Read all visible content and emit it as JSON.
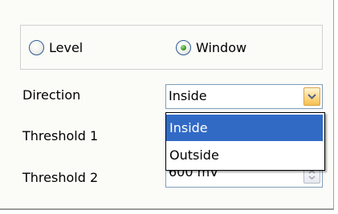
{
  "mode": {
    "options": [
      {
        "label": "Level",
        "checked": false
      },
      {
        "label": "Window",
        "checked": true
      }
    ]
  },
  "direction": {
    "label": "Direction",
    "selected": "Inside",
    "options": [
      "Inside",
      "Outside"
    ],
    "highlighted_option": "Inside"
  },
  "threshold1": {
    "label": "Threshold 1"
  },
  "threshold2": {
    "label": "Threshold 2",
    "value": "600 mV"
  },
  "colors": {
    "selection": "#316ac5",
    "dropdown_button": "#ffd98a",
    "field_border": "#7f9db9",
    "panel_background": "#fbfbf8"
  },
  "icons": {
    "dropdown_button": "chevron-down-icon",
    "spin_button": "spinner-icon"
  }
}
